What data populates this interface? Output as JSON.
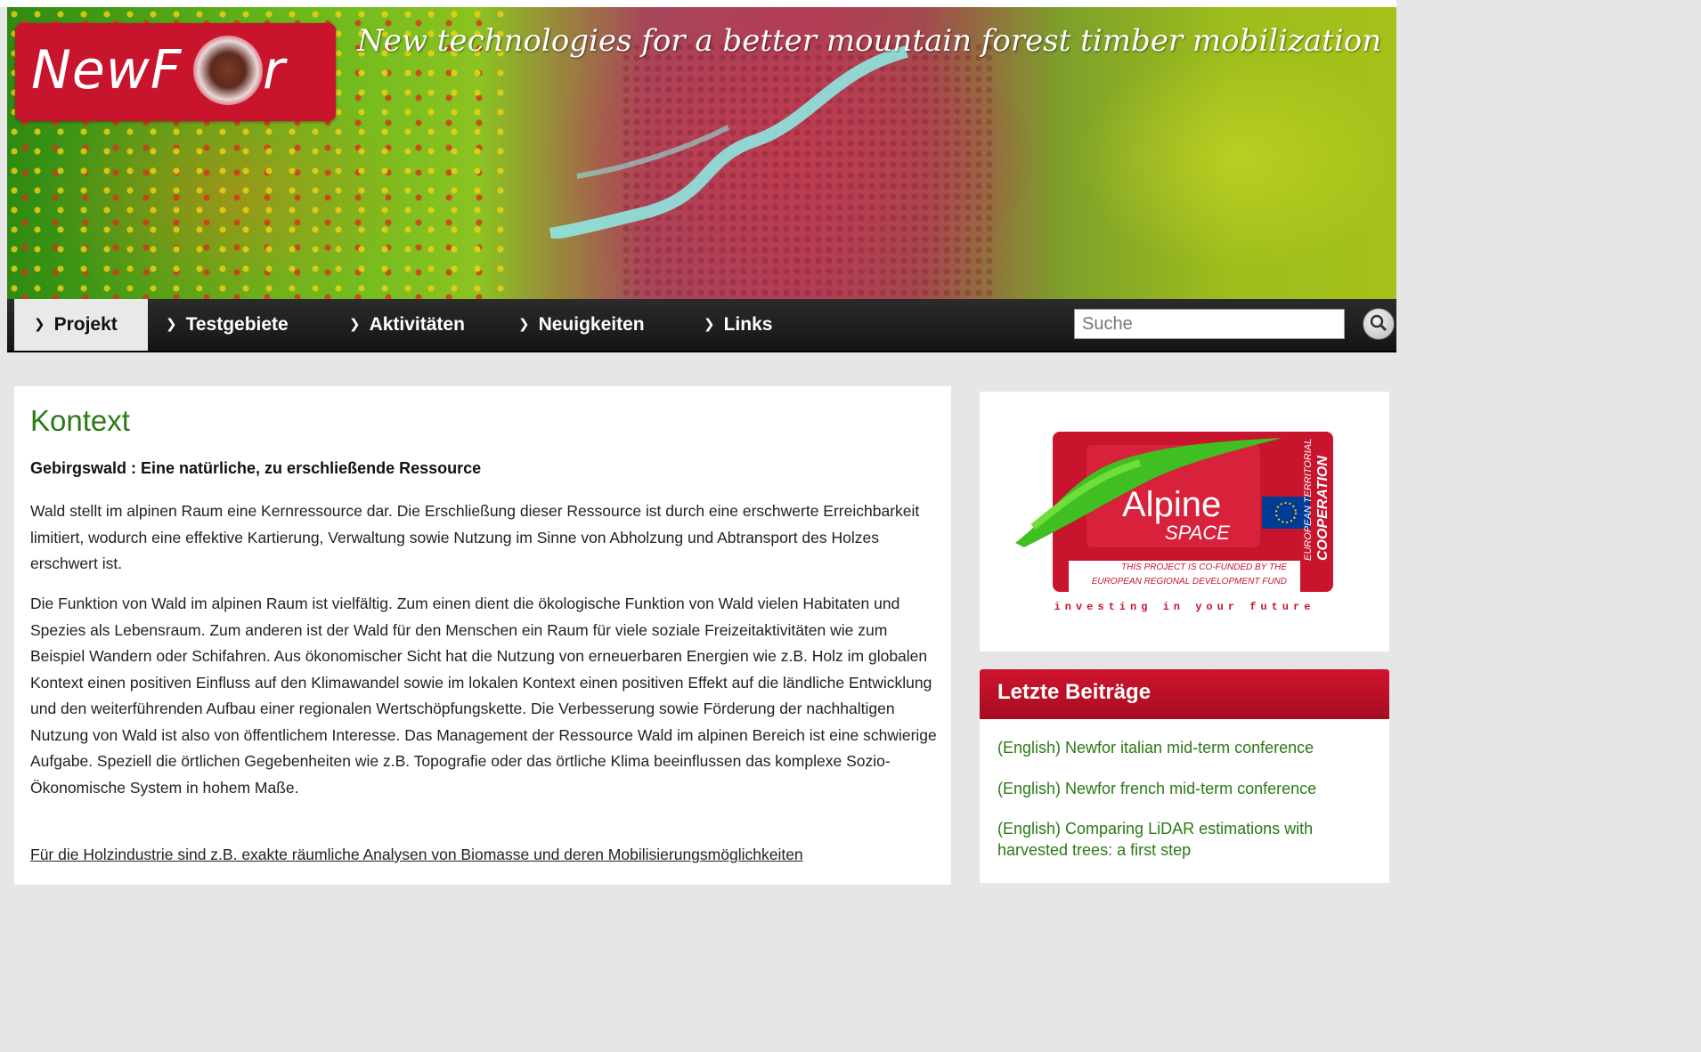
{
  "header": {
    "logo_text": "NewF",
    "logo_text_end": "r",
    "tagline": "New technologies for a better mountain forest timber mobilization"
  },
  "nav": {
    "items": [
      {
        "label": "Projekt",
        "active": true
      },
      {
        "label": "Testgebiete",
        "active": false
      },
      {
        "label": "Aktivitäten",
        "active": false
      },
      {
        "label": "Neuigkeiten",
        "active": false
      },
      {
        "label": "Links",
        "active": false
      }
    ],
    "search_placeholder": "Suche"
  },
  "main": {
    "title": "Kontext",
    "subtitle": "Gebirgswald : Eine natürliche, zu erschließende Ressource",
    "paragraphs": [
      "Wald stellt im alpinen Raum eine Kernressource dar. Die Erschließung dieser Ressource ist durch eine erschwerte Erreichbarkeit limitiert, wodurch eine effektive Kartierung, Verwaltung sowie Nutzung im Sinne von Abholzung und Abtransport des Holzes erschwert ist.",
      "Die Funktion von Wald im alpinen Raum ist vielfältig. Zum einen dient die ökologische Funktion von Wald vielen Habitaten und Spezies als Lebensraum. Zum anderen ist der Wald für den Menschen ein Raum für viele soziale Freizeitaktivitäten wie zum Beispiel Wandern oder Schifahren. Aus ökonomischer Sicht hat die Nutzung von erneuerbaren Energien wie z.B. Holz im globalen Kontext einen positiven Einfluss auf den Klimawandel sowie im lokalen Kontext einen positiven Effekt auf die ländliche Entwicklung und den weiterführenden Aufbau einer regionalen Wertschöpfungskette. Die Verbesserung sowie Förderung der nachhaltigen Nutzung von Wald ist also von öffentlichem Interesse. Das Management der Ressource Wald im alpinen Bereich ist eine schwierige Aufgabe. Speziell die örtlichen Gegebenheiten wie z.B. Topografie oder das örtliche Klima beeinflussen das komplexe Sozio-Ökonomische System in hohem Maße.",
      "Für die Holzindustrie sind z.B. exakte räumliche Analysen von Biomasse und deren Mobilisierungsmöglichkeiten"
    ]
  },
  "sidebar": {
    "alpine_logo": {
      "name": "Alpine",
      "space": "SPACE",
      "side_text_1": "EUROPEAN TERRITORIAL",
      "side_text_2": "COOPERATION",
      "funded_line_1": "THIS PROJECT IS CO-FUNDED BY THE",
      "funded_line_2": "EUROPEAN REGIONAL DEVELOPMENT FUND",
      "slogan": "investing in your future"
    },
    "recent_posts": {
      "title": "Letzte Beiträge",
      "items": [
        "(English) Newfor italian mid-term conference",
        "(English) Newfor french mid-term conference",
        "(English) Comparing LiDAR estimations with harvested trees: a first step"
      ]
    }
  },
  "colors": {
    "brand_red": "#c8142d",
    "link_green": "#2a7a14",
    "nav_bg": "#1c1c1c"
  }
}
